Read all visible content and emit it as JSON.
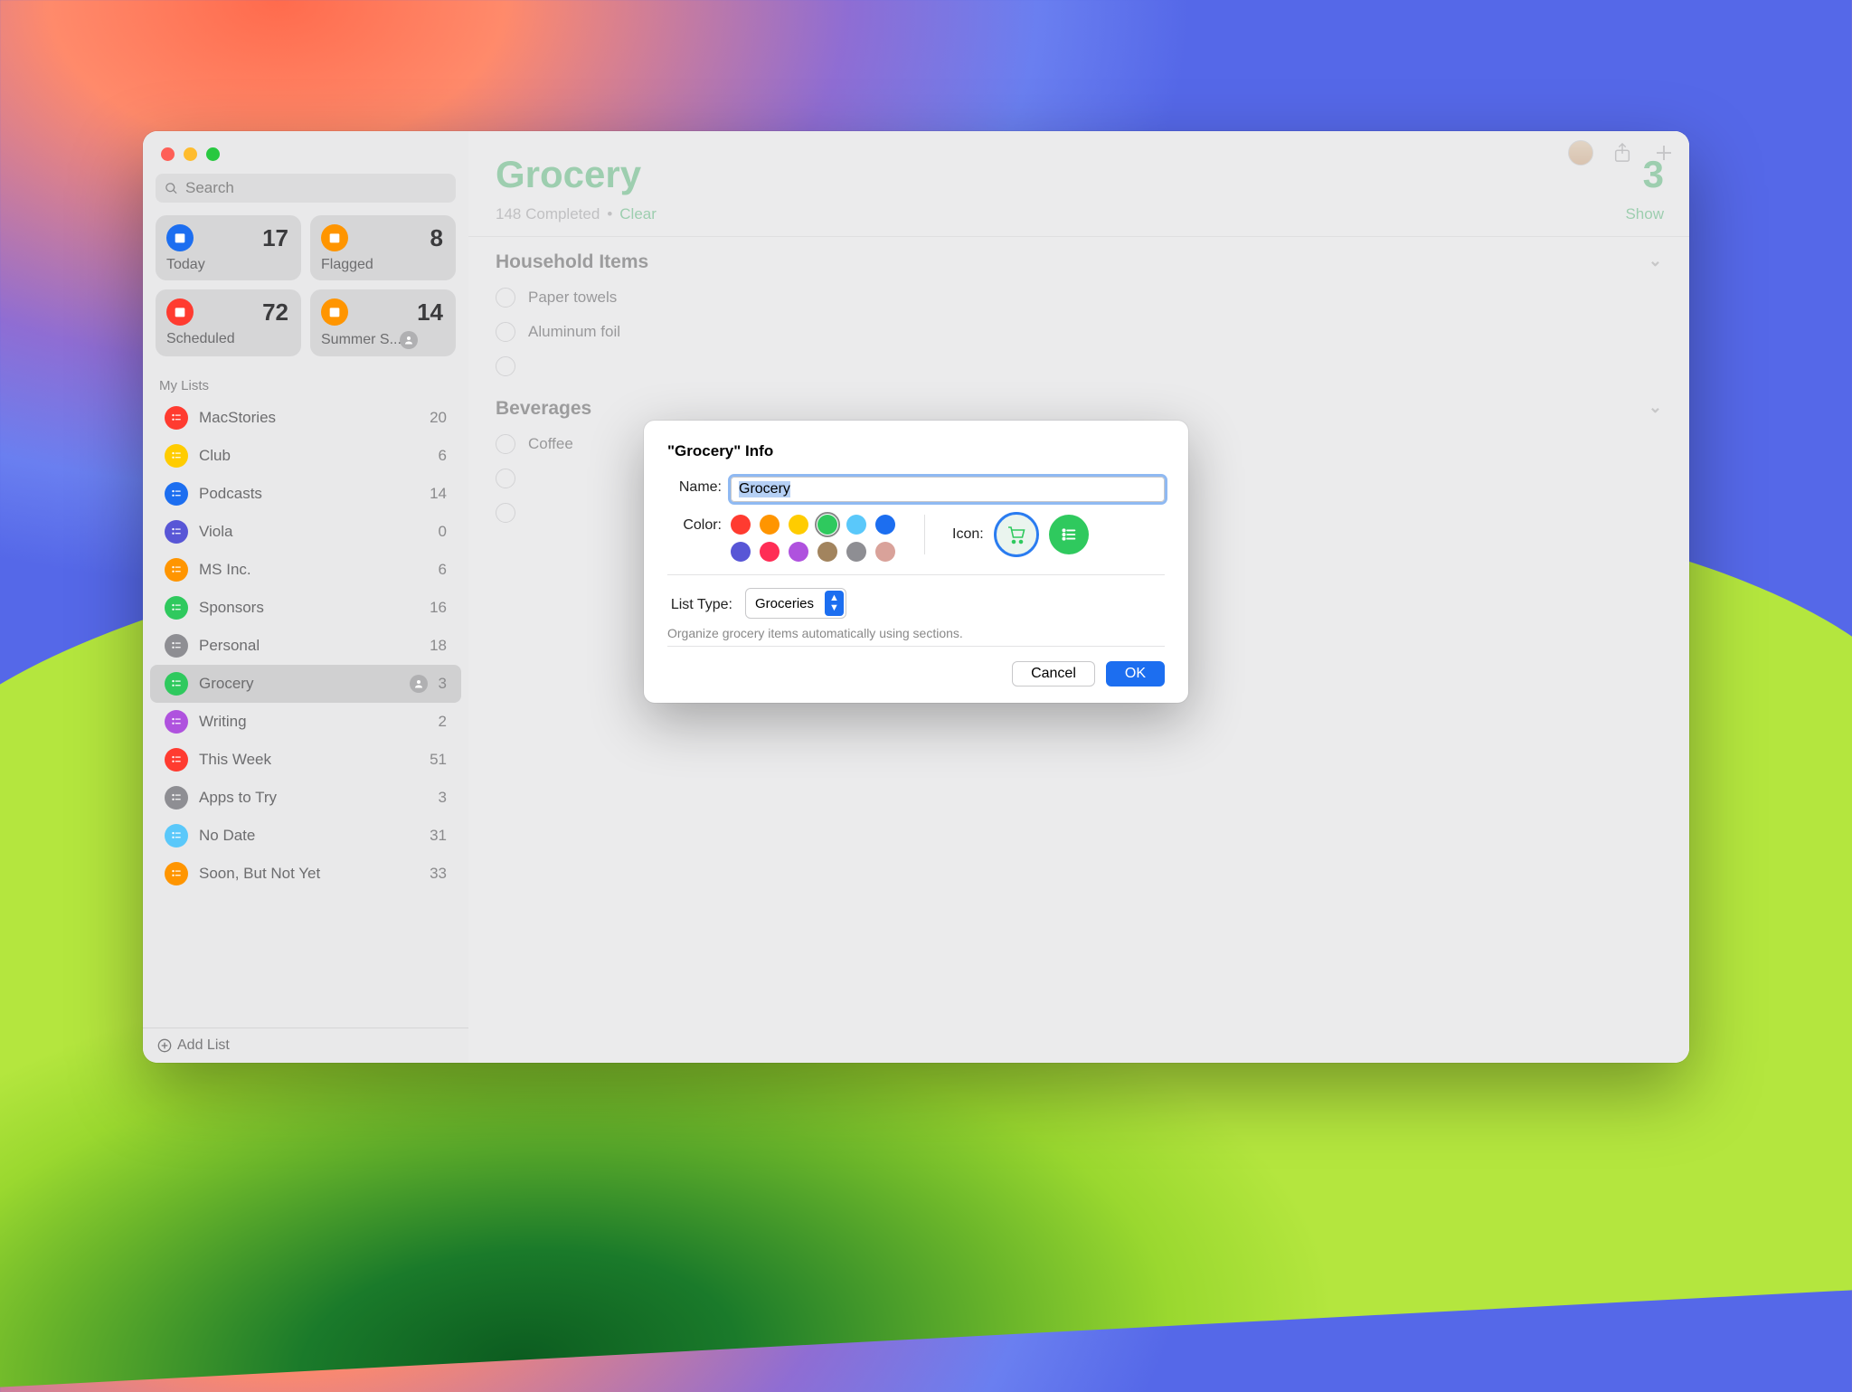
{
  "traffic_colors": [
    "#fe5f57",
    "#febc2e",
    "#28c840"
  ],
  "search": {
    "placeholder": "Search"
  },
  "smart_lists": [
    {
      "label": "Today",
      "count": "17",
      "color": "#1c6ef0",
      "icon": "calendar"
    },
    {
      "label": "Flagged",
      "count": "8",
      "color": "#ff9500",
      "icon": "flag"
    },
    {
      "label": "Scheduled",
      "count": "72",
      "color": "#ff3b30",
      "icon": "calendar-alt"
    },
    {
      "label": "Summer S...",
      "count": "14",
      "color": "#ff9500",
      "icon": "sun",
      "shared": true
    }
  ],
  "section_header": "My Lists",
  "lists": [
    {
      "name": "MacStories",
      "count": "20",
      "color": "#ff3b30"
    },
    {
      "name": "Club",
      "count": "6",
      "color": "#ffcc00"
    },
    {
      "name": "Podcasts",
      "count": "14",
      "color": "#1c6ef0"
    },
    {
      "name": "Viola",
      "count": "0",
      "color": "#5856d6"
    },
    {
      "name": "MS Inc.",
      "count": "6",
      "color": "#ff9500"
    },
    {
      "name": "Sponsors",
      "count": "16",
      "color": "#2fc95e"
    },
    {
      "name": "Personal",
      "count": "18",
      "color": "#8e8e93"
    },
    {
      "name": "Grocery",
      "count": "3",
      "color": "#2fc95e",
      "selected": true,
      "shared": true
    },
    {
      "name": "Writing",
      "count": "2",
      "color": "#af52de"
    },
    {
      "name": "This Week",
      "count": "51",
      "color": "#ff3b30"
    },
    {
      "name": "Apps to Try",
      "count": "3",
      "color": "#8e8e93"
    },
    {
      "name": "No Date",
      "count": "31",
      "color": "#5ac8fa"
    },
    {
      "name": "Soon, But Not Yet",
      "count": "33",
      "color": "#ff9500"
    }
  ],
  "add_list_label": "Add List",
  "main": {
    "title": "Grocery",
    "title_color": "#45b96f",
    "count": "3",
    "completed_text": "148 Completed",
    "clear_label": "Clear",
    "show_label": "Show",
    "sections": [
      {
        "title": "Household Items",
        "items": [
          "Paper towels",
          "Aluminum foil",
          ""
        ]
      },
      {
        "title": "Beverages",
        "items": [
          "Coffee",
          "",
          ""
        ]
      }
    ]
  },
  "sheet": {
    "title": "\"Grocery\" Info",
    "name_label": "Name:",
    "name_value": "Grocery",
    "color_label": "Color:",
    "colors": [
      "#ff3b30",
      "#ff9500",
      "#ffcc00",
      "#2fc95e",
      "#5ac8fa",
      "#1c6ef0",
      "#5856d6",
      "#ff2d55",
      "#af52de",
      "#a2845e",
      "#8e8e93",
      "#d9a29a"
    ],
    "selected_color_index": 3,
    "icon_label": "Icon:",
    "list_type_label": "List Type:",
    "list_type_value": "Groceries",
    "list_type_help": "Organize grocery items automatically using sections.",
    "cancel_label": "Cancel",
    "ok_label": "OK"
  }
}
